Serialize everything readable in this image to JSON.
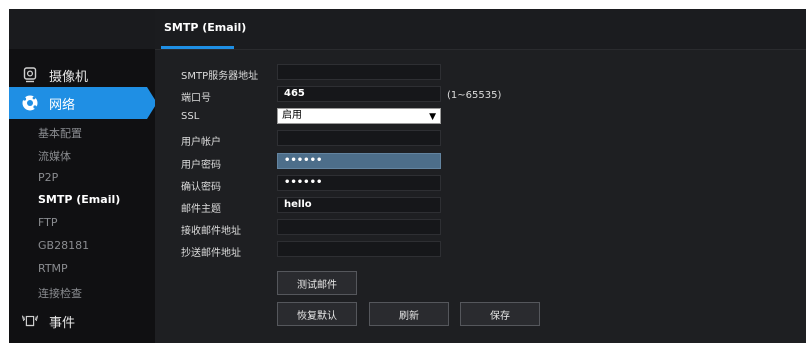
{
  "tab": {
    "title": "SMTP (Email)"
  },
  "sidebar": {
    "camera_label": "摄像机",
    "network_label": "网络",
    "event_label": "事件",
    "items": [
      "基本配置",
      "流媒体",
      "P2P",
      "SMTP (Email)",
      "FTP",
      "GB28181",
      "RTMP",
      "连接检查"
    ],
    "active_index": 3
  },
  "form": {
    "server_label": "SMTP服务器地址",
    "server_value": "",
    "port_label": "端口号",
    "port_value": "465",
    "port_hint": "(1~65535)",
    "ssl_label": "SSL",
    "ssl_value": "启用",
    "user_label": "用户帐户",
    "user_value": "",
    "pwd_label": "用户密码",
    "pwd_value": "••••••",
    "pwd2_label": "确认密码",
    "pwd2_value": "••••••",
    "subject_label": "邮件主题",
    "subject_value": "hello",
    "to_label": "接收邮件地址",
    "to_value": "",
    "cc_label": "抄送邮件地址",
    "cc_value": ""
  },
  "buttons": {
    "test": "测试邮件",
    "restore": "恢复默认",
    "refresh": "刷新",
    "save": "保存"
  },
  "colors": {
    "accent": "#1f8fe4",
    "focus_field": "#4d6e8a"
  }
}
